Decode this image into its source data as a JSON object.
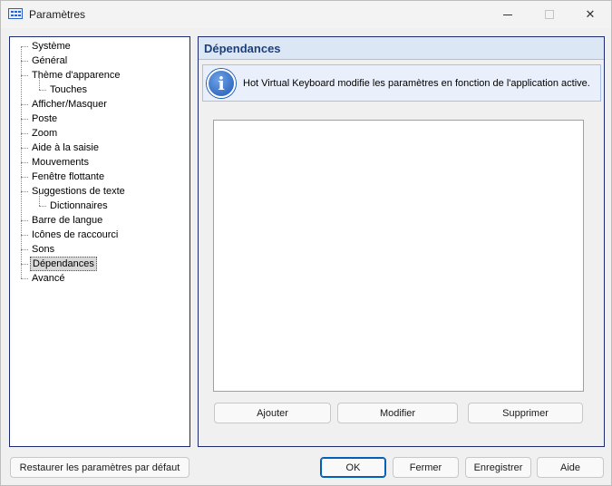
{
  "window": {
    "title": "Paramètres"
  },
  "tree": {
    "items": [
      {
        "label": "Système",
        "level": 0
      },
      {
        "label": "Général",
        "level": 0
      },
      {
        "label": "Thème d'apparence",
        "level": 0
      },
      {
        "label": "Touches",
        "level": 1
      },
      {
        "label": "Afficher/Masquer",
        "level": 0
      },
      {
        "label": "Poste",
        "level": 0
      },
      {
        "label": "Zoom",
        "level": 0
      },
      {
        "label": "Aide à la saisie",
        "level": 0
      },
      {
        "label": "Mouvements",
        "level": 0
      },
      {
        "label": "Fenêtre flottante",
        "level": 0
      },
      {
        "label": "Suggestions de texte",
        "level": 0
      },
      {
        "label": "Dictionnaires",
        "level": 1
      },
      {
        "label": "Barre de langue",
        "level": 0
      },
      {
        "label": "Icônes de raccourci",
        "level": 0
      },
      {
        "label": "Sons",
        "level": 0
      },
      {
        "label": "Dépendances",
        "level": 0,
        "selected": true
      },
      {
        "label": "Avancé",
        "level": 0
      }
    ]
  },
  "panel": {
    "title": "Dépendances",
    "info_text": "Hot Virtual Keyboard modifie les paramètres en fonction de l'application active.",
    "add_label": "Ajouter",
    "edit_label": "Modifier",
    "delete_label": "Supprimer"
  },
  "footer": {
    "restore_label": "Restaurer les paramètres par défaut",
    "ok_label": "OK",
    "close_label": "Fermer",
    "save_label": "Enregistrer",
    "help_label": "Aide"
  },
  "colors": {
    "accent": "#005fb8",
    "header_bg": "#dce7f6",
    "header_text": "#1e3f7a"
  }
}
